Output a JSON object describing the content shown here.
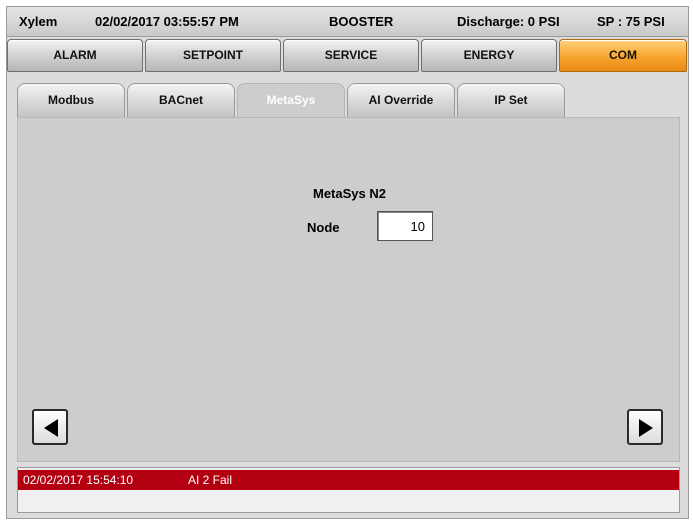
{
  "header": {
    "brand": "Xylem",
    "datetime": "02/02/2017 03:55:57 PM",
    "mode": "BOOSTER",
    "discharge": "Discharge: 0 PSI",
    "setpoint": "SP : 75 PSI"
  },
  "main_tabs": [
    {
      "label": "ALARM",
      "active": false
    },
    {
      "label": "SETPOINT",
      "active": false
    },
    {
      "label": "SERVICE",
      "active": false
    },
    {
      "label": "ENERGY",
      "active": false
    },
    {
      "label": "COM",
      "active": true
    }
  ],
  "sub_tabs": [
    {
      "label": "Modbus",
      "active": false
    },
    {
      "label": "BACnet",
      "active": false
    },
    {
      "label": "MetaSys",
      "active": true
    },
    {
      "label": "AI Override",
      "active": false
    },
    {
      "label": "IP Set",
      "active": false
    }
  ],
  "content": {
    "title": "MetaSys N2",
    "node_label": "Node",
    "node_value": "10"
  },
  "nav": {
    "prev_icon": "left-triangle-icon",
    "next_icon": "right-triangle-icon"
  },
  "alarm": {
    "time": "02/02/2017 15:54:10",
    "message": "AI 2 Fail",
    "color": "#b30010"
  },
  "colors": {
    "active_main_tab": "#f7a530",
    "header_bg": "#d8d8d8"
  }
}
